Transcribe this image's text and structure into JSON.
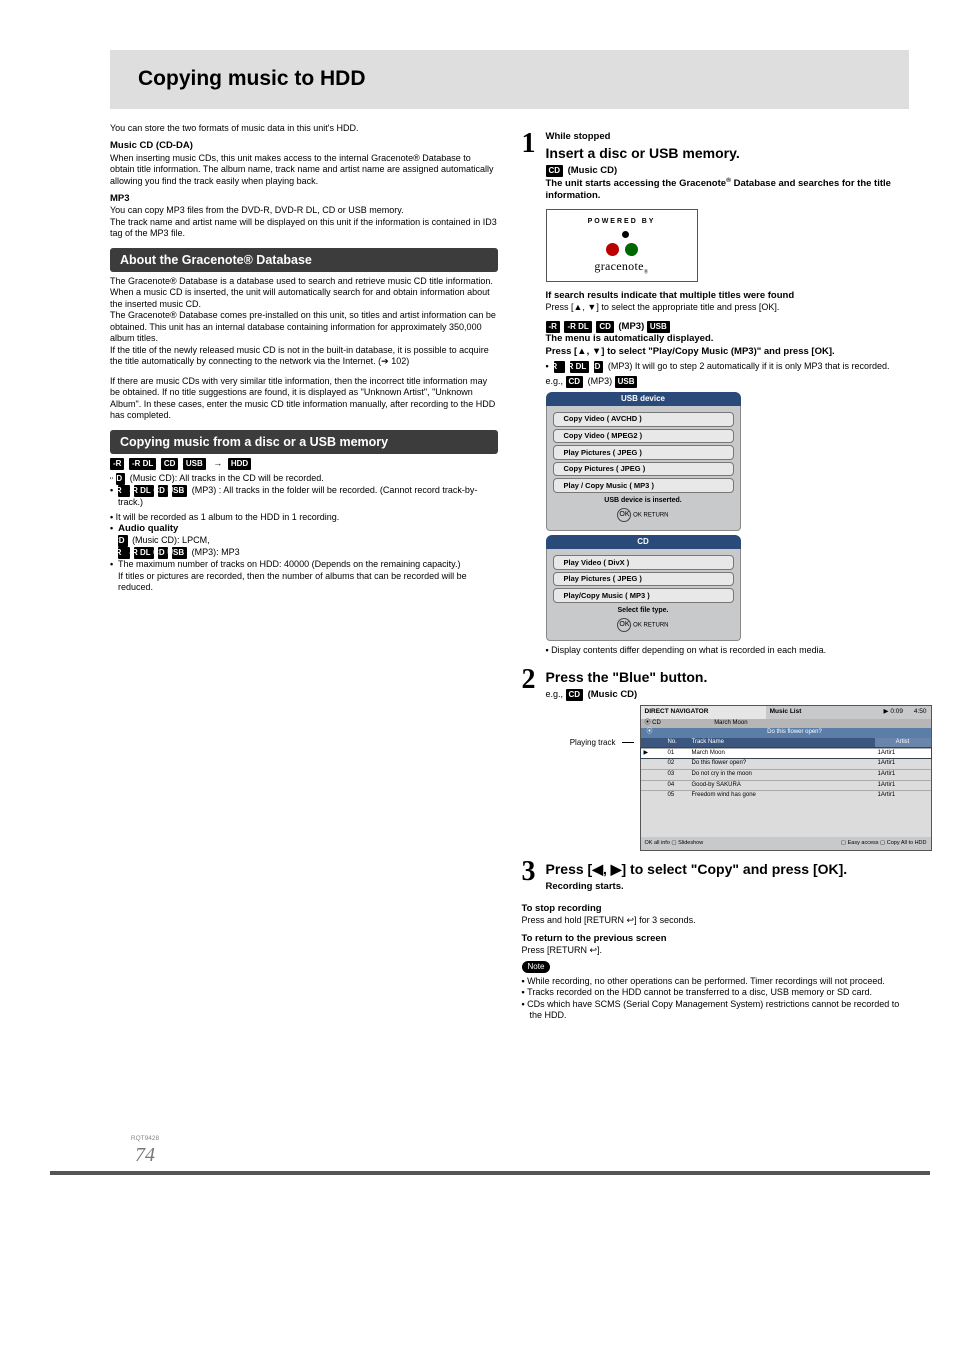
{
  "page_title": "Copying music to HDD",
  "intro": "You can store the two formats of music data in this unit's HDD.",
  "music_cd": {
    "heading": "Music CD (CD-DA)",
    "body": "When inserting music CDs, this unit makes access to the internal Gracenote® Database to obtain title information. The album name, track name and artist name are assigned automatically allowing you find the track easily when playing back."
  },
  "mp3": {
    "heading": "MP3",
    "body1": "You can copy MP3 files from the DVD-R, DVD-R DL, CD or USB memory.",
    "body2": "The track name and artist name will be displayed on this unit if the information is contained in ID3 tag of the MP3 file."
  },
  "about_db": {
    "heading": "About the Gracenote® Database",
    "p1": "The Gracenote® Database is a database used to search and retrieve music CD title information.",
    "p2": "When a music CD is inserted, the unit will automatically search for and obtain information about the inserted music CD.",
    "p3": "The Gracenote® Database comes pre-installed on this unit, so titles and artist information can be obtained. This unit has an internal database containing information for approximately 350,000 album titles.",
    "p4": "If the title of the newly released music CD is not in the built-in database, it is possible to acquire the title automatically by connecting to the network via the Internet. (➔ 102)",
    "p5": "If there are music CDs with very similar title information, then the incorrect title information may be obtained. If no title suggestions are found, it is displayed as \"Unknown Artist\", \"Unknown Album\". In these cases, enter the music CD title information manually, after recording to the HDD has completed."
  },
  "copy_from": {
    "heading": "Copying music from a disc or a USB memory",
    "tags_src": [
      "-R",
      "-R DL",
      "CD",
      "USB"
    ],
    "tags_dst": [
      "HDD"
    ],
    "bul1_pre": "CD",
    "bul1": " (Music CD): All tracks in the CD will be recorded.",
    "bul2_tags": [
      "-R",
      "-R DL",
      "CD",
      "USB"
    ],
    "bul2": " (MP3) : All tracks in the folder will be recorded. (Cannot record track-by-track.)",
    "bul3": "It will be recorded as 1 album to the HDD in 1 recording.",
    "aq_label": "Audio quality",
    "aq1_pre": "CD",
    "aq1": " (Music CD): LPCM,",
    "aq2_tags": [
      "-R",
      "-R DL",
      "CD",
      "USB"
    ],
    "aq2": " (MP3): MP3",
    "bul4": "The maximum number of tracks on HDD: 40000 (Depends on the remaining capacity.)",
    "bul4b": "If titles or pictures are recorded, then the number of albums that can be recorded will be reduced."
  },
  "step1": {
    "num": "1",
    "while": "While stopped",
    "title": "Insert a disc or USB memory.",
    "cd_tag": "CD",
    "cd_label": " (Music CD)",
    "p1a": "The unit starts accessing the Gracenote",
    "p1b": " Database and searches for the title information.",
    "gn_powered": "POWERED BY",
    "gn_word": "gracenote",
    "found_bold": "If search results indicate that multiple titles were found",
    "found_body": "Press [▲, ▼] to select the appropriate title and press [OK].",
    "tags_line": [
      "-R",
      "-R DL",
      "CD"
    ],
    "mp3_label": " (MP3) ",
    "tags_usb": "USB",
    "menu_auto": "The menu is automatically displayed.",
    "press_line": "Press [▲, ▼] to select \"Play/Copy Music (MP3)\" and press [OK].",
    "only_tags": [
      "-R",
      "-R DL",
      "CD"
    ],
    "only_body": " (MP3) It will go to step 2 automatically if it is only MP3 that is recorded.",
    "eg_label": "e.g., ",
    "eg_cd": "CD",
    "eg_rest": " (MP3) ",
    "eg_usb": "USB",
    "usb_panel": {
      "title": "USB device",
      "items": [
        "Copy Video ( AVCHD )",
        "Copy Video ( MPEG2 )",
        "Play Pictures ( JPEG )",
        "Copy Pictures ( JPEG )",
        "Play / Copy Music ( MP3 )"
      ],
      "sub": "USB device is inserted.",
      "foot": "OK  RETURN"
    },
    "cd_panel": {
      "title": "CD",
      "items": [
        "Play Video ( DivX )",
        "Play Pictures ( JPEG )",
        "Play/Copy Music ( MP3 )"
      ],
      "sub": "Select file type.",
      "foot": "OK  RETURN"
    },
    "display_note": "Display contents differ depending on what is recorded in each media."
  },
  "step2": {
    "num": "2",
    "title": "Press the \"Blue\" button.",
    "eg_label": "e.g., ",
    "eg_cd": "CD",
    "eg_rest": " (Music CD)",
    "playing": "Playing track",
    "nav": {
      "hdr_left": "DIRECT NAVIGATOR",
      "hdr_mid": "Music List",
      "hdr_right_top": "▶ 0:09",
      "hdr_right_side": "4:50",
      "hdr_sub_cd": "⦿ CD",
      "hdr_sub_title": "March Moon",
      "question": "Do this flower open?",
      "cols": [
        "No.",
        "Track Name",
        "Artist"
      ],
      "rows": [
        [
          "▶",
          "01",
          "March Moon",
          "1Artir1"
        ],
        [
          "",
          "02",
          "Do this flower open?",
          "1Artir1"
        ],
        [
          "",
          "03",
          "Do not cry in the moon",
          "1Artir1"
        ],
        [
          "",
          "04",
          "Good-by SAKURA",
          "1Artir1"
        ],
        [
          "",
          "05",
          "Freedom wind has gone",
          "1Artir1"
        ]
      ],
      "foot_left": "OK all info ▢ Slideshow",
      "foot_right": "▢ Easy access ▢ Copy All to HDD"
    }
  },
  "step3": {
    "num": "3",
    "title": "Press [◀, ▶] to select \"Copy\" and press [OK].",
    "sub": "Recording starts."
  },
  "post": {
    "stop_h": "To stop recording",
    "stop_b": "Press and hold [RETURN ↩] for 3 seconds.",
    "ret_h": "To return to the previous screen",
    "ret_b": "Press [RETURN ↩].",
    "note_label": "Note",
    "n1": "While recording, no other operations can be performed. Timer recordings will not proceed.",
    "n2": "Tracks recorded on the HDD cannot be transferred to a disc, USB memory or SD card.",
    "n3": "CDs which have SCMS (Serial Copy Management System) restrictions cannot be recorded to the HDD."
  },
  "footer": {
    "rqt": "RQT9428",
    "page": "74"
  }
}
